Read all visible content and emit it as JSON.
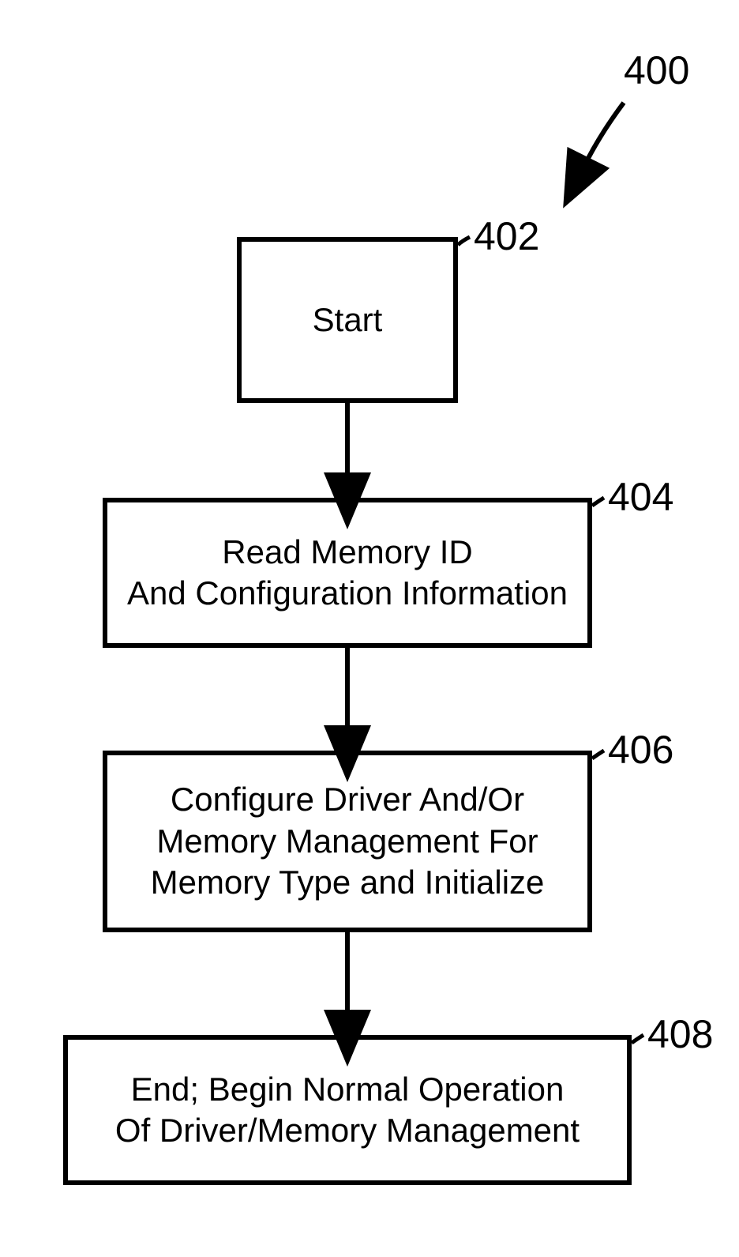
{
  "figure_label": "400",
  "nodes": {
    "start": {
      "label": "402",
      "text": "Start"
    },
    "read": {
      "label": "404",
      "text": "Read Memory ID\nAnd Configuration Information"
    },
    "conf": {
      "label": "406",
      "text": "Configure Driver And/Or\nMemory Management For\nMemory Type and Initialize"
    },
    "end": {
      "label": "408",
      "text": "End; Begin Normal Operation\nOf Driver/Memory Management"
    }
  }
}
